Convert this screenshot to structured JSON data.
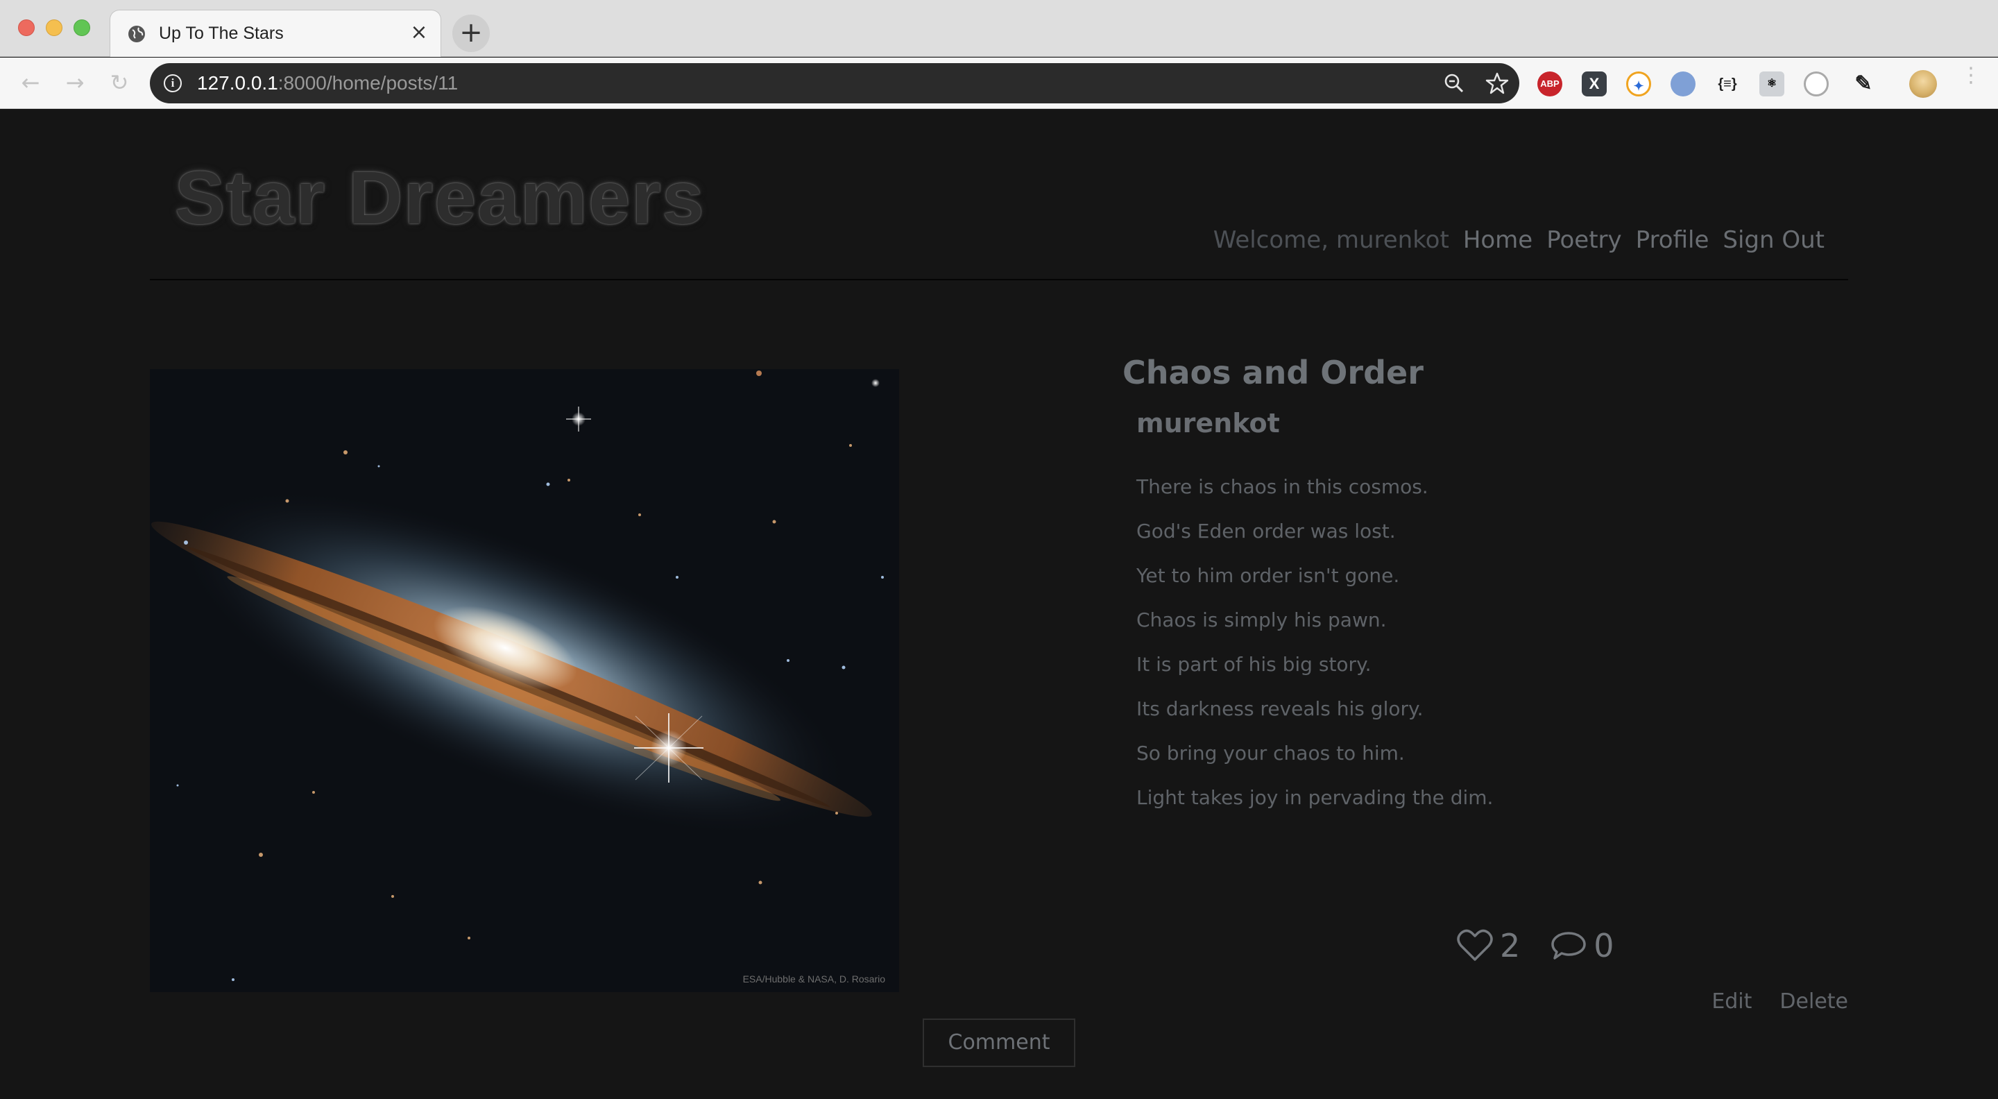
{
  "browser": {
    "tab_title": "Up To The Stars",
    "new_tab_label": "+",
    "close_label": "×",
    "url_host": "127.0.0.1",
    "url_rest": ":8000/home/posts/11",
    "extensions": [
      "ABP",
      "X",
      "compass",
      "ring",
      "{≡}",
      "react",
      "timer",
      "eyedropper"
    ]
  },
  "site": {
    "logo": "Star Dreamers",
    "nav": {
      "welcome": "Welcome, murenkot",
      "home": "Home",
      "poetry": "Poetry",
      "profile": "Profile",
      "signout": "Sign Out"
    }
  },
  "post": {
    "image_credit": "ESA/Hubble & NASA, D. Rosario",
    "title": "Chaos and Order",
    "author": "murenkot",
    "lines": [
      "There is chaos in this cosmos.",
      "God's Eden order was lost.",
      "Yet to him order isn't gone.",
      "Chaos is simply his pawn.",
      "It is part of his big story.",
      "Its darkness reveals his glory.",
      "So bring your chaos to him.",
      "Light takes joy in pervading the dim."
    ],
    "likes": "2",
    "comments": "0",
    "edit_label": "Edit",
    "delete_label": "Delete",
    "comment_button": "Comment"
  },
  "colors": {
    "page_background": "#151515",
    "text_muted": "#6e7378"
  }
}
